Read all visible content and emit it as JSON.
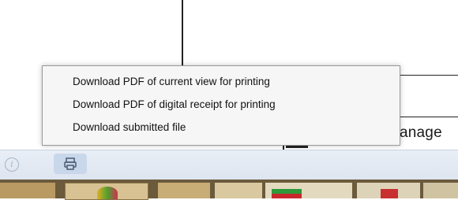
{
  "menu": {
    "items": [
      {
        "label": "Download PDF of current view for printing"
      },
      {
        "label": "Download PDF of digital receipt for printing"
      },
      {
        "label": "Download submitted file"
      }
    ]
  },
  "document": {
    "partial_text": "anage"
  },
  "toolbar": {
    "info_icon_glyph": "i",
    "print_icon": "printer-icon"
  },
  "colors": {
    "menu_bg": "#f6f6f6",
    "toolbar_bg": "#e2e9f3",
    "print_button_bg": "#c9d7ea",
    "taskbar_bg": "#6b5a3c"
  }
}
